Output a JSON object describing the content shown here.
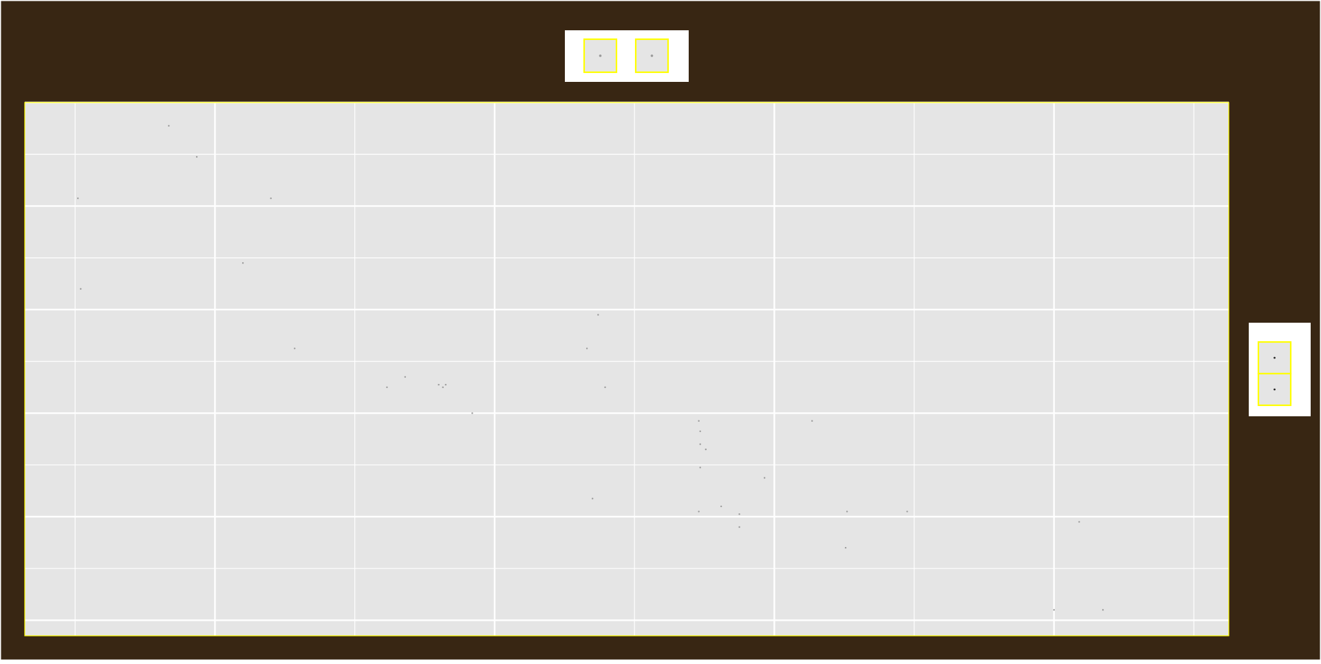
{
  "colors": {
    "background": "#382613",
    "panel": "#e5e5e5",
    "grid": "#ffffff",
    "outline": "#ffff00",
    "legend_bg": "#ffffff",
    "point": "#9a9a9a",
    "point_dark": "#222222"
  },
  "legends": {
    "top": {
      "keys": [
        "point-grey",
        "point-grey"
      ]
    },
    "right": {
      "keys": [
        "point-dark",
        "point-dark"
      ]
    }
  },
  "chart_data": {
    "type": "scatter",
    "title": "",
    "xlabel": "",
    "ylabel": "",
    "xlim": [
      -0.36,
      8.25
    ],
    "ylim": [
      -0.3,
      10.0
    ],
    "grid": true,
    "x_breaks_major": [
      1,
      3,
      5,
      7
    ],
    "x_breaks_minor": [
      0,
      2,
      4,
      6,
      8
    ],
    "y_breaks_major": [
      0,
      2,
      4,
      6,
      8,
      10
    ],
    "y_breaks_minor": [
      1,
      3,
      5,
      7,
      9
    ],
    "legend_placement": [
      "top",
      "right"
    ],
    "series": [
      {
        "x": [
          0.67,
          0.87,
          0.02,
          1.4,
          1.2,
          0.04,
          1.57,
          2.36,
          2.23,
          2.65,
          2.63,
          2.84,
          2.6,
          3.74,
          3.66,
          3.79,
          4.46,
          5.27,
          4.47,
          4.47,
          4.51,
          4.47,
          4.93,
          3.7,
          4.46,
          5.95,
          4.62,
          5.52,
          4.75,
          4.75,
          5.51,
          7.18,
          7.0,
          7.35
        ],
        "y": [
          9.55,
          8.95,
          8.15,
          8.15,
          6.9,
          6.4,
          5.25,
          4.7,
          4.5,
          4.55,
          4.5,
          4.0,
          4.55,
          5.9,
          5.25,
          4.5,
          3.85,
          3.85,
          3.65,
          3.4,
          3.3,
          2.95,
          2.75,
          2.35,
          2.1,
          2.1,
          2.2,
          2.1,
          2.05,
          1.8,
          1.4,
          1.9,
          0.2,
          0.2
        ]
      }
    ]
  }
}
